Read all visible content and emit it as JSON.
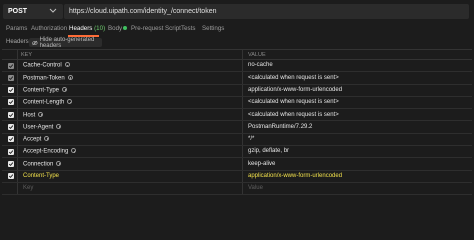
{
  "request": {
    "method": "POST",
    "url": "https://cloud.uipath.com/identity_/connect/token"
  },
  "tabs": [
    {
      "label": "Params"
    },
    {
      "label": "Authorization"
    },
    {
      "label": "Headers",
      "count": "(10)"
    },
    {
      "label": "Body"
    },
    {
      "label": "Pre-request Script"
    },
    {
      "label": "Tests"
    },
    {
      "label": "Settings"
    }
  ],
  "active_tab": "Headers",
  "subheader": {
    "section_label": "Headers",
    "hide_button": "Hide auto-generated headers"
  },
  "table": {
    "key_header": "KEY",
    "value_header": "VALUE",
    "rows": [
      {
        "key": "Cache-Control",
        "value": "no-cache",
        "checked": true,
        "auto": true
      },
      {
        "key": "Postman-Token",
        "value": "<calculated when request is sent>",
        "checked": true,
        "auto": true
      },
      {
        "key": "Content-Type",
        "value": "application/x-www-form-urlencoded",
        "checked": true,
        "auto": true
      },
      {
        "key": "Content-Length",
        "value": "<calculated when request is sent>",
        "checked": true,
        "auto": true
      },
      {
        "key": "Host",
        "value": "<calculated when request is sent>",
        "checked": true,
        "auto": true
      },
      {
        "key": "User-Agent",
        "value": "PostmanRuntime/7.29.2",
        "checked": true,
        "auto": true
      },
      {
        "key": "Accept",
        "value": "*/*",
        "checked": true,
        "auto": true
      },
      {
        "key": "Accept-Encoding",
        "value": "gzip, deflate, br",
        "checked": true,
        "auto": true
      },
      {
        "key": "Connection",
        "value": "keep-alive",
        "checked": true,
        "auto": true
      },
      {
        "key": "Content-Type",
        "value": "application/x-www-form-urlencoded",
        "checked": true,
        "auto": false
      }
    ],
    "placeholder_row": {
      "key": "Key",
      "value": "Value"
    }
  },
  "colors": {
    "accent": "#ff6c37",
    "highlight_text": "#f2e14b",
    "background": "#1c1c1c"
  }
}
